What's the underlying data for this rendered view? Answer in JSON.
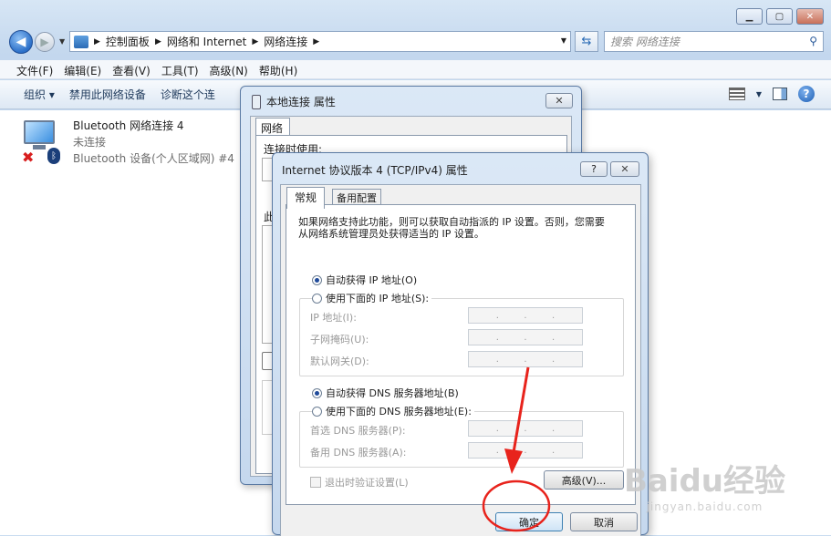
{
  "window": {
    "minimize_icon": "minimize-icon",
    "maximize_icon": "maximize-icon",
    "close_icon": "close-icon"
  },
  "nav": {
    "breadcrumb": [
      "控制面板",
      "网络和 Internet",
      "网络连接"
    ],
    "search_placeholder": "搜索 网络连接"
  },
  "menu": [
    "文件(F)",
    "编辑(E)",
    "查看(V)",
    "工具(T)",
    "高级(N)",
    "帮助(H)"
  ],
  "commands": [
    "组织 ▾",
    "禁用此网络设备",
    "诊断这个连"
  ],
  "connection": {
    "name": "Bluetooth 网络连接 4",
    "status": "未连接",
    "device": "Bluetooth 设备(个人区域网) #4"
  },
  "dialog_local": {
    "title": "本地连接 属性",
    "tab": "网络",
    "label1": "连接时使用:",
    "label2": "此"
  },
  "dialog_ipv4": {
    "title": "Internet 协议版本 4 (TCP/IPv4) 属性",
    "help": "?",
    "tabs": [
      "常规",
      "备用配置"
    ],
    "description": "如果网络支持此功能，则可以获取自动指派的 IP 设置。否则，您需要从网络系统管理员处获得适当的 IP 设置。",
    "auto_ip": "自动获得 IP 地址(O)",
    "manual_ip": "使用下面的 IP 地址(S):",
    "ip_label": "IP 地址(I):",
    "subnet_label": "子网掩码(U):",
    "gateway_label": "默认网关(D):",
    "auto_dns": "自动获得 DNS 服务器地址(B)",
    "manual_dns": "使用下面的 DNS 服务器地址(E):",
    "preferred_dns": "首选 DNS 服务器(P):",
    "alternate_dns": "备用 DNS 服务器(A):",
    "validate": "退出时验证设置(L)",
    "advanced": "高级(V)...",
    "ok": "确定",
    "cancel": "取消",
    "dot": "."
  },
  "watermark": {
    "text": "Baidu经验",
    "url": "jingyan.baidu.com"
  },
  "colors": {
    "annotation": "#e8231c"
  }
}
